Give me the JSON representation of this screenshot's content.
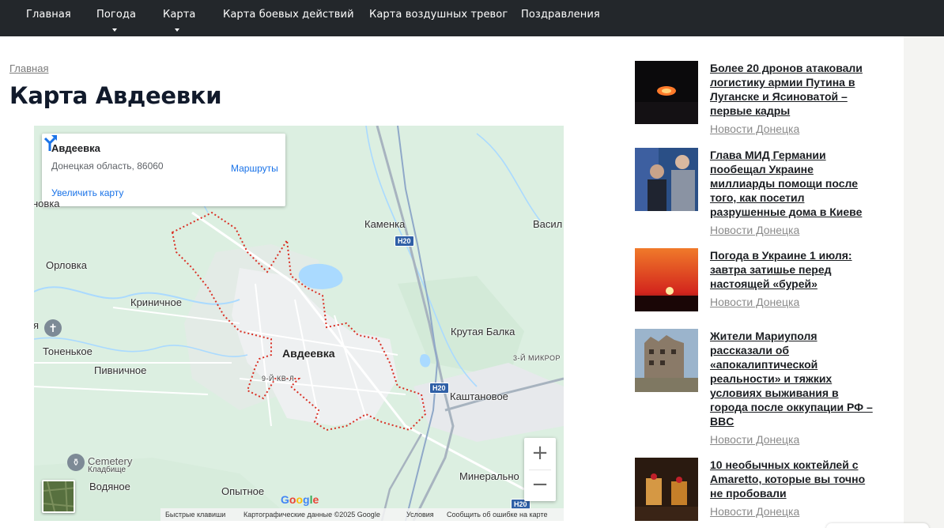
{
  "nav": {
    "items": [
      {
        "label": "Главная",
        "dropdown": false
      },
      {
        "label": "Погода",
        "dropdown": true
      },
      {
        "label": "Карта",
        "dropdown": true
      },
      {
        "label": "Карта боевых действий",
        "dropdown": false
      },
      {
        "label": "Карта воздушных тревог",
        "dropdown": false
      },
      {
        "label": "Поздравления",
        "dropdown": false
      }
    ]
  },
  "breadcrumb": "Главная",
  "page_title": "Карта Авдеевки",
  "map": {
    "card_title": "Авдеевка",
    "card_address": "Донецкая область, 86060",
    "card_enlarge": "Увеличить карту",
    "card_routes": "Маршруты",
    "labels": {
      "kamenka": "Каменка",
      "vasil": "Васил",
      "orlovka": "Орловка",
      "krinichnoe": "Криничное",
      "tonenkoe": "Тоненькое",
      "pivnichnoe": "Пивничное",
      "avdeevka": "Авдеевка",
      "kv9": "9-Й КВ-Л",
      "krutaya_balka": "Крутая Балка",
      "mikror": "3-Й МИКРОР",
      "kashtanovoe": "Каштановое",
      "mineralnoe": "Минерально",
      "opytnoe": "Опытное",
      "vodyanoe": "Водяное",
      "cemetery": "Cemetery",
      "kladbishche": "Кладбище",
      "novka": "новка",
      "ya": "я"
    },
    "road_shield": "H20",
    "zoom_in": "+",
    "zoom_out": "−",
    "google": "Google",
    "attribution": {
      "shortcuts": "Быстрые клавиши",
      "data": "Картографические данные ©2025 Google",
      "terms": "Условия",
      "report": "Сообщить об ошибке на карте"
    }
  },
  "news": [
    {
      "title": "Более 20 дронов атаковали логистику армии Путина в Луганске и Ясиноватой – первые кадры",
      "source": "Новости Донецка"
    },
    {
      "title": "Глава МИД Германии пообещал Украине миллиарды помощи после того, как посетил разрушенные дома в Киеве",
      "source": "Новости Донецка"
    },
    {
      "title": "Погода в Украине 1 июля: завтра затишье перед настоящей «бурей»",
      "source": "Новости Донецка"
    },
    {
      "title": "Жители Мариуполя рассказали об «апокалиптической реальности» и тяжких условиях выживания в города после оккупации РФ – BBC",
      "source": "Новости Донецка"
    },
    {
      "title": "10 необычных коктейлей с Amaretto, которые вы точно не пробовали",
      "source": "Новости Донецка"
    }
  ],
  "colors": {
    "nav_bg": "#23272b",
    "title": "#111a2b",
    "boundary": "#d93025",
    "link_blue": "#1a73e8"
  }
}
